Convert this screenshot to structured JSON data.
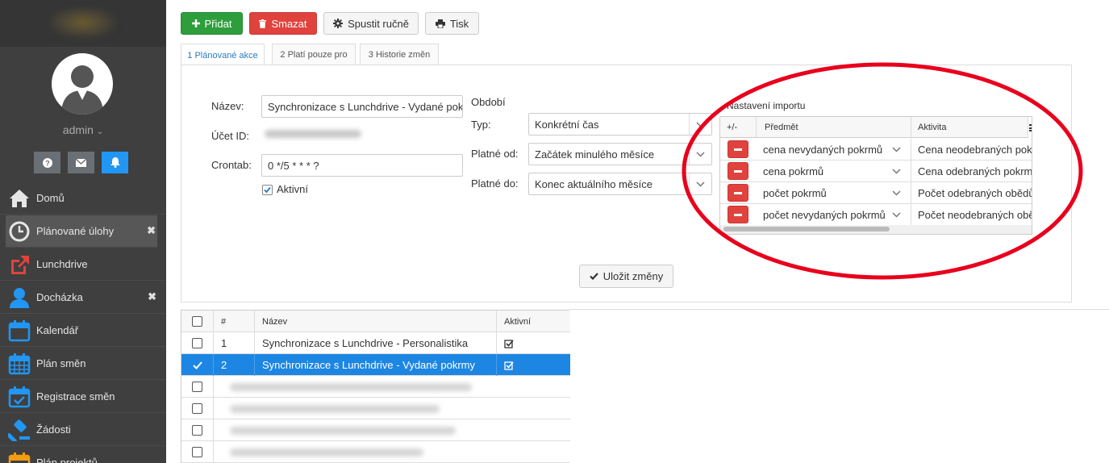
{
  "sidebar": {
    "user": "admin",
    "nav": [
      {
        "label": "Domů",
        "icon": "home-icon",
        "closable": false
      },
      {
        "label": "Plánované úlohy",
        "icon": "clock-icon",
        "closable": true,
        "active": true
      },
      {
        "label": "Lunchdrive",
        "icon": "external-link-icon",
        "closable": false
      },
      {
        "label": "Docházka",
        "icon": "person-icon",
        "closable": true
      },
      {
        "label": "Kalendář",
        "icon": "calendar-icon",
        "closable": false
      },
      {
        "label": "Plán směn",
        "icon": "calendar-grid-icon",
        "closable": false
      },
      {
        "label": "Registrace směn",
        "icon": "calendar-check-icon",
        "closable": false
      },
      {
        "label": "Žádosti",
        "icon": "gavel-icon",
        "closable": false
      },
      {
        "label": "Plán projektů",
        "icon": "calendar-orange-icon",
        "closable": false
      }
    ],
    "colors": {
      "bg": "#3f3f3f",
      "active": "#575757",
      "icon_blue": "#2196f3",
      "icon_red": "#e0433d"
    }
  },
  "toolbar": {
    "add": "Přidat",
    "delete": "Smazat",
    "run": "Spustit ručně",
    "print": "Tisk"
  },
  "tabs": [
    "1 Plánované akce",
    "2 Platí pouze pro",
    "3 Historie změn"
  ],
  "form": {
    "name_label": "Název:",
    "name_value": "Synchronizace s Lunchdrive - Vydané pokrmy",
    "account_label": "Účet ID:",
    "crontab_label": "Crontab:",
    "crontab_value": "0 */5 * * * ?",
    "active_label": "Aktivní",
    "period_title": "Období",
    "type_label": "Typ:",
    "type_value": "Konkrétní čas",
    "from_label": "Platné od:",
    "from_value": "Začátek minulého měsíce",
    "to_label": "Platné do:",
    "to_value": "Konec aktuálního měsíce",
    "save": "Uložit změny"
  },
  "import": {
    "title": "Nastavení importu",
    "headers": [
      "+/-",
      "Předmět",
      "Aktivita"
    ],
    "rows": [
      {
        "subject": "cena nevydaných pokrmů",
        "activity": "Cena neodebraných pokrmů"
      },
      {
        "subject": "cena pokrmů",
        "activity": "Cena odebraných pokrmů"
      },
      {
        "subject": "počet pokrmů",
        "activity": "Počet odebraných obědů"
      },
      {
        "subject": "počet nevydaných pokrmů",
        "activity": "Počet neodebraných obědů"
      }
    ]
  },
  "list": {
    "headers": [
      "#",
      "Název",
      "Aktivní"
    ],
    "rows": [
      {
        "num": "1",
        "name": "Synchronizace s Lunchdrive - Personalistika",
        "selected": false
      },
      {
        "num": "2",
        "name": "Synchronizace s Lunchdrive - Vydané pokrmy",
        "selected": true
      }
    ]
  },
  "annotation": {
    "color": "#e8001c"
  }
}
